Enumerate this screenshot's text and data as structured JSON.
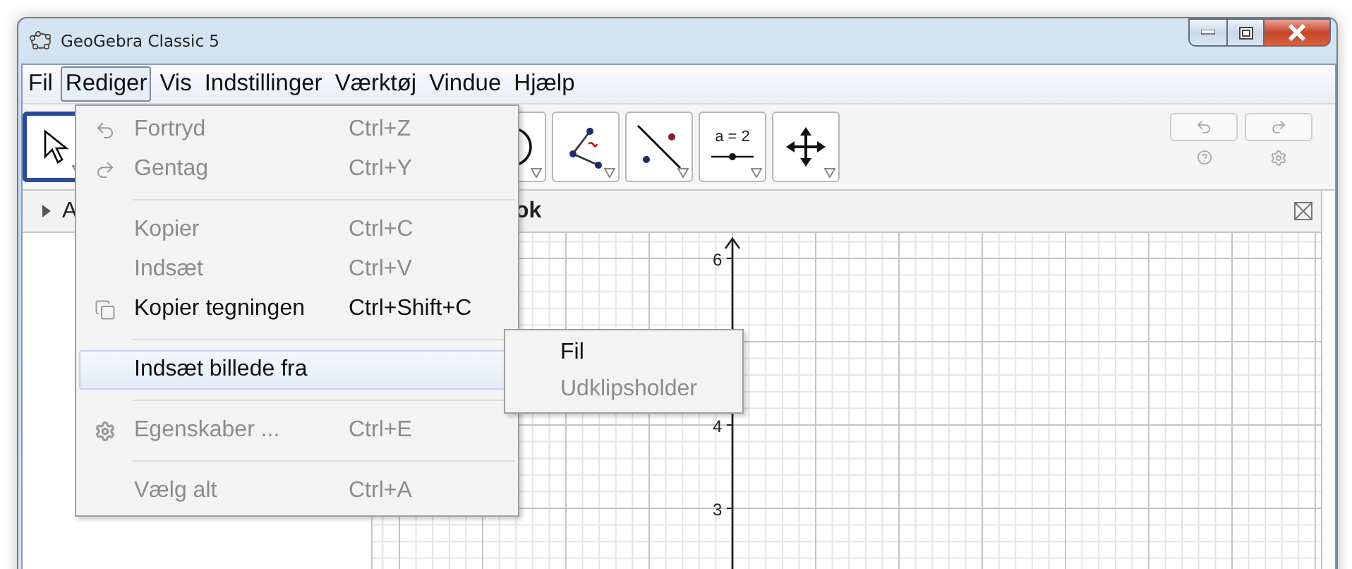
{
  "window": {
    "title": "GeoGebra Classic 5"
  },
  "menu_bar": [
    {
      "label": "Fil",
      "selected": false
    },
    {
      "label": "Rediger",
      "selected": true
    },
    {
      "label": "Vis",
      "selected": false
    },
    {
      "label": "Indstillinger",
      "selected": false
    },
    {
      "label": "Værktøj",
      "selected": false
    },
    {
      "label": "Vindue",
      "selected": false
    },
    {
      "label": "Hjælp",
      "selected": false
    }
  ],
  "toolbar": {
    "tools": [
      {
        "kind": "move",
        "selected": true
      },
      {
        "kind": "gap"
      },
      {
        "kind": "circle",
        "selected": false
      },
      {
        "kind": "angle",
        "selected": false
      },
      {
        "kind": "reflect",
        "selected": false
      },
      {
        "kind": "slider",
        "selected": false,
        "label": "a = 2"
      },
      {
        "kind": "move_view",
        "selected": false
      }
    ]
  },
  "algebra_view": {
    "title": "A"
  },
  "graphics_view": {
    "title": "ok",
    "y_labels": [
      "6",
      "4",
      "3"
    ]
  },
  "edit_menu": {
    "items": [
      {
        "kind": "item",
        "label": "Fortryd",
        "shortcut": "Ctrl+Z",
        "disabled": true,
        "selected": false
      },
      {
        "kind": "item",
        "label": "Gentag",
        "shortcut": "Ctrl+Y",
        "disabled": true,
        "selected": false
      },
      {
        "kind": "separator"
      },
      {
        "kind": "item",
        "label": "Kopier",
        "shortcut": "Ctrl+C",
        "disabled": true,
        "selected": false
      },
      {
        "kind": "item",
        "label": "Indsæt",
        "shortcut": "Ctrl+V",
        "disabled": true,
        "selected": false
      },
      {
        "kind": "item",
        "label": "Kopier tegningen",
        "shortcut": "Ctrl+Shift+C",
        "disabled": false,
        "selected": false
      },
      {
        "kind": "separator"
      },
      {
        "kind": "submenu",
        "label": "Indsæt billede fra",
        "disabled": false,
        "selected": true
      },
      {
        "kind": "separator"
      },
      {
        "kind": "item",
        "label": "Egenskaber ...",
        "shortcut": "Ctrl+E",
        "disabled": true,
        "selected": false
      },
      {
        "kind": "separator"
      },
      {
        "kind": "item",
        "label": "Vælg alt",
        "shortcut": "Ctrl+A",
        "disabled": true,
        "selected": false
      }
    ]
  },
  "submenu": {
    "items": [
      {
        "label": "Fil",
        "disabled": false
      },
      {
        "label": "Udklipsholder",
        "disabled": true
      }
    ]
  }
}
